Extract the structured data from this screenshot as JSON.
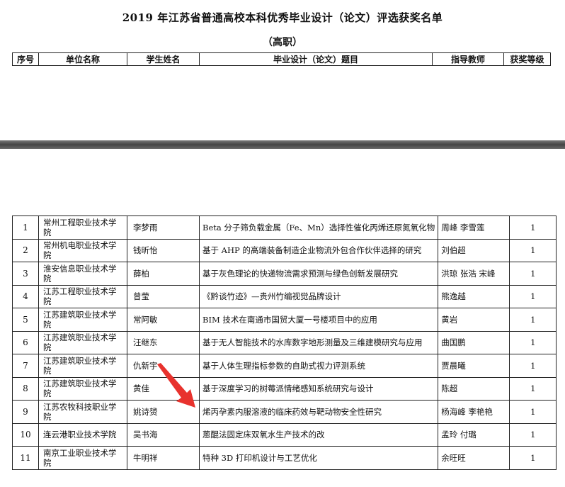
{
  "document": {
    "title": "2019 年江苏省普通高校本科优秀毕业设计（论文）评选获奖名单",
    "subtitle": "（高职）"
  },
  "table": {
    "headers": [
      "序号",
      "单位名称",
      "学生姓名",
      "毕业设计（论文）题目",
      "指导教师",
      "获奖等级"
    ],
    "rows": [
      {
        "no": "1",
        "unit": "常州工程职业技术学院",
        "student": "李梦雨",
        "topic": "Beta 分子筛负载金属（Fe、Mn）选择性催化丙烯还原氮氧化物",
        "teacher": "周峰 李雪莲",
        "award": "1"
      },
      {
        "no": "2",
        "unit": "常州机电职业技术学院",
        "student": "钱昕怡",
        "topic": "基于 AHP 的高端装备制造企业物流外包合作伙伴选择的研究",
        "teacher": "刘伯超",
        "award": "1"
      },
      {
        "no": "3",
        "unit": "淮安信息职业技术学院",
        "student": "薛柏",
        "topic": "基于灰色理论的快递物流需求预测与绿色创新发展研究",
        "teacher": "洪琼 张浩 宋峰",
        "award": "1"
      },
      {
        "no": "4",
        "unit": "江苏工程职业技术学院",
        "student": "曾莹",
        "topic": "《黔谈竹迹》—贵州竹编视觉品牌设计",
        "teacher": "熊逸越",
        "award": "1"
      },
      {
        "no": "5",
        "unit": "江苏建筑职业技术学院",
        "student": "常阿敏",
        "topic": "BIM 技术在南通市国贸大厦一号楼项目中的应用",
        "teacher": "黄岩",
        "award": "1"
      },
      {
        "no": "6",
        "unit": "江苏建筑职业技术学院",
        "student": "汪继东",
        "topic": "基于无人智能技术的水库数字地形测量及三维建模研究与应用",
        "teacher": "曲国鹏",
        "award": "1"
      },
      {
        "no": "7",
        "unit": "江苏建筑职业技术学院",
        "student": "仇新宇",
        "topic": "基于人体生理指标参数的自助式视力评测系统",
        "teacher": "贾晨曦",
        "award": "1"
      },
      {
        "no": "8",
        "unit": "江苏建筑职业技术学院",
        "student": "黄佳",
        "topic": "基于深度学习的树莓派情绪感知系统研究与设计",
        "teacher": "陈超",
        "award": "1"
      },
      {
        "no": "9",
        "unit": "江苏农牧科技职业学院",
        "student": "姚诗赟",
        "topic": "烯丙孕素内服溶液的临床药效与靶动物安全性研究",
        "teacher": "杨海峰 李艳艳",
        "award": "1"
      },
      {
        "no": "10",
        "unit": "连云港职业技术学院",
        "student": "吴书海",
        "topic": "蒽醌法固定床双氧水生产技术的改",
        "teacher": "孟玲 付璐",
        "award": "1"
      },
      {
        "no": "11",
        "unit": "南京工业职业技术学院",
        "student": "牛明祥",
        "topic": "特种 3D 打印机设计与工艺优化",
        "teacher": "余旺旺",
        "award": "1"
      }
    ]
  },
  "colors": {
    "arrow": "#e8322d",
    "divider": "#555555"
  }
}
